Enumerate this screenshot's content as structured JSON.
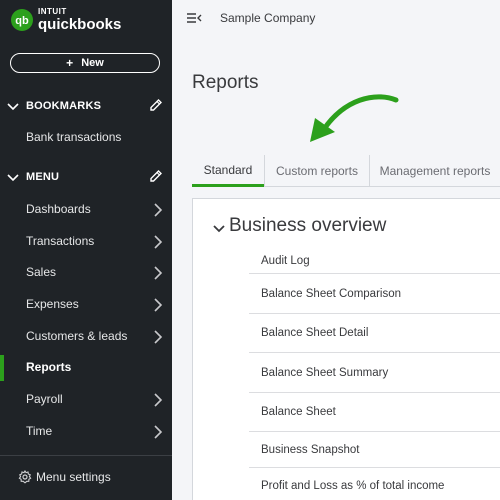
{
  "brand": {
    "intuit": "INTUIT",
    "name": "quickbooks",
    "accent": "#2ca01c"
  },
  "sidebar": {
    "new_label": "New",
    "bookmarks_label": "BOOKMARKS",
    "bookmarks": [
      {
        "label": "Bank transactions"
      }
    ],
    "menu_label": "MENU",
    "items": [
      {
        "label": "Dashboards",
        "has_arrow": true
      },
      {
        "label": "Transactions",
        "has_arrow": true
      },
      {
        "label": "Sales",
        "has_arrow": true
      },
      {
        "label": "Expenses",
        "has_arrow": true
      },
      {
        "label": "Customers & leads",
        "has_arrow": true
      },
      {
        "label": "Reports",
        "has_arrow": false,
        "active": true
      },
      {
        "label": "Payroll",
        "has_arrow": true
      },
      {
        "label": "Time",
        "has_arrow": true
      }
    ],
    "settings_label": "Menu settings"
  },
  "header": {
    "company": "Sample Company"
  },
  "main": {
    "title": "Reports",
    "tabs": [
      {
        "label": "Standard",
        "active": true
      },
      {
        "label": "Custom reports",
        "active": false
      },
      {
        "label": "Management reports",
        "active": false
      }
    ],
    "group": {
      "title": "Business overview",
      "reports": [
        "Audit Log",
        "Balance Sheet Comparison",
        "Balance Sheet Detail",
        "Balance Sheet Summary",
        "Balance Sheet",
        "Business Snapshot",
        "Profit and Loss as % of total income"
      ]
    }
  }
}
